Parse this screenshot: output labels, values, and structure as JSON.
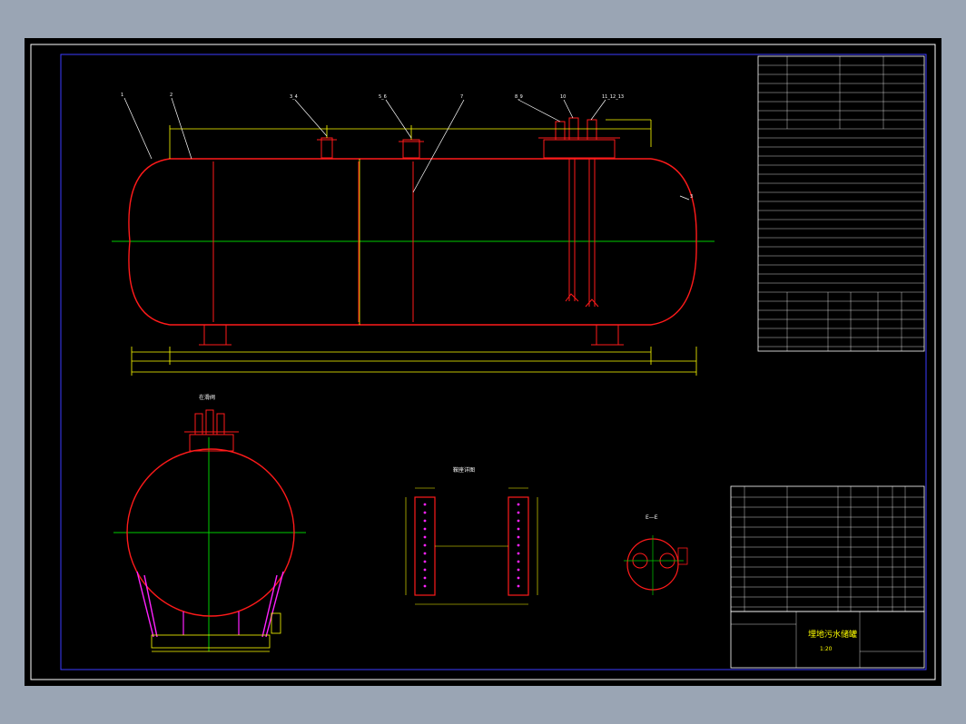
{
  "drawing": {
    "title": "埋地污水储罐",
    "scale": "1:20",
    "colors": {
      "background": "#000000",
      "frame": "#ffffff",
      "inner_frame": "#3b3bff",
      "vessel": "#ff1a1a",
      "centerline": "#00cc00",
      "dimension": "#ffff00",
      "support": "#ff22ff",
      "leader": "#ffffff"
    }
  },
  "views": {
    "section_label": "E—E",
    "front_view_label": "在滑阀"
  }
}
